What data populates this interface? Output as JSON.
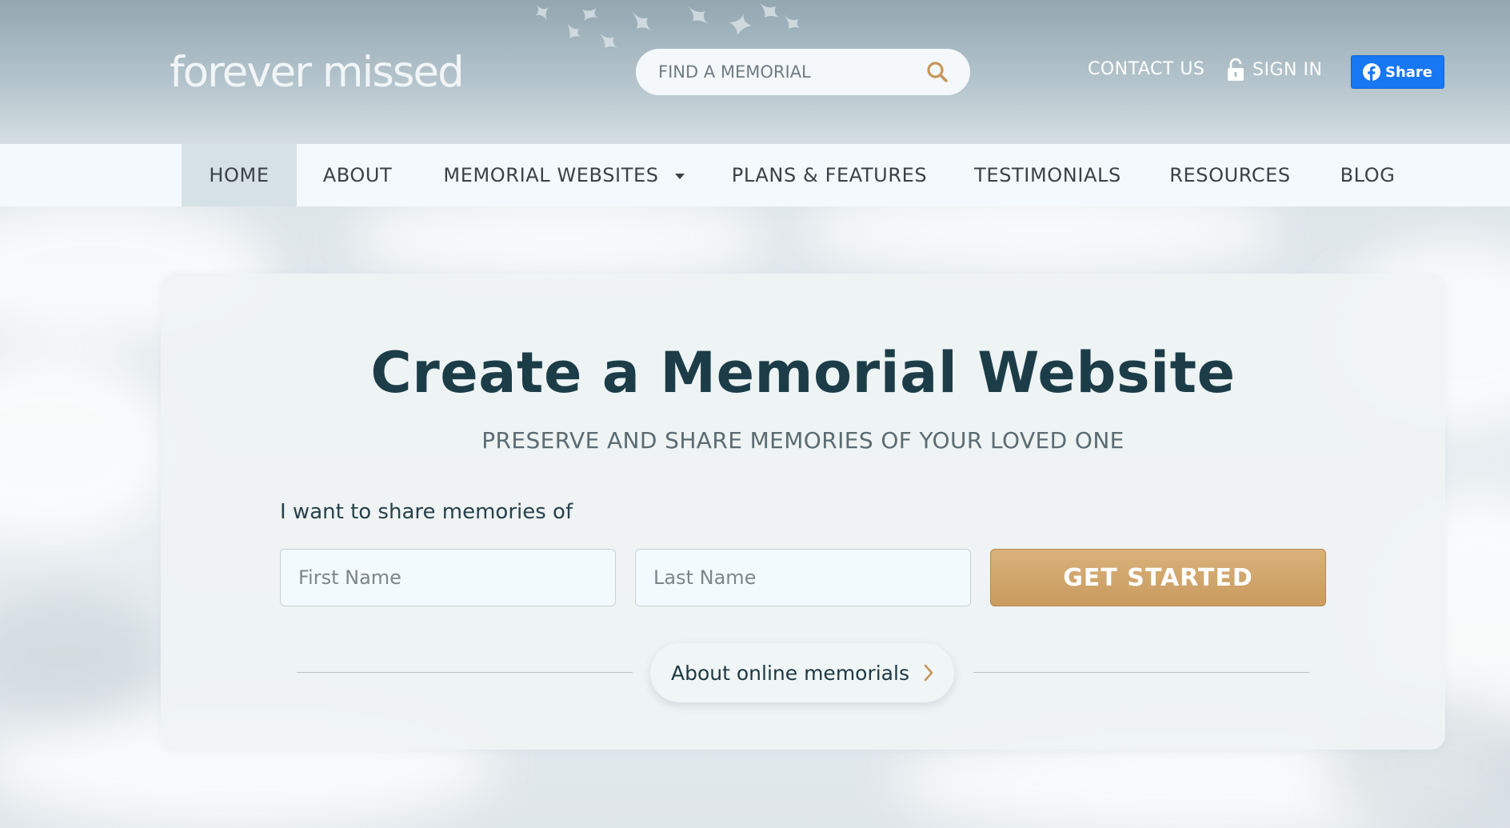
{
  "header": {
    "logo_text": "forever missed",
    "search_placeholder": "FIND A MEMORIAL",
    "contact_label": "CONTACT US",
    "signin_label": "SIGN IN",
    "share_label": "Share"
  },
  "nav": {
    "items": [
      {
        "label": "HOME",
        "active": true
      },
      {
        "label": "ABOUT"
      },
      {
        "label": "MEMORIAL WEBSITES",
        "has_dropdown": true
      },
      {
        "label": "PLANS & FEATURES"
      },
      {
        "label": "TESTIMONIALS"
      },
      {
        "label": "RESOURCES"
      },
      {
        "label": "BLOG"
      }
    ]
  },
  "hero": {
    "title": "Create a Memorial Website",
    "subtitle": "PRESERVE AND SHARE MEMORIES OF YOUR LOVED ONE",
    "prompt": "I want to share memories of",
    "first_name_placeholder": "First Name",
    "last_name_placeholder": "Last Name",
    "cta_label": "GET STARTED",
    "about_link": "About online memorials"
  },
  "colors": {
    "brand_dark": "#1c3d48",
    "cta_gold": "#c99b5f",
    "facebook_blue": "#1877f2",
    "nav_active_bg": "#d5e1e5"
  },
  "icons": [
    "flame-logo-icon",
    "search-icon",
    "lock-icon",
    "facebook-icon",
    "chevron-down-icon",
    "chevron-right-icon"
  ]
}
